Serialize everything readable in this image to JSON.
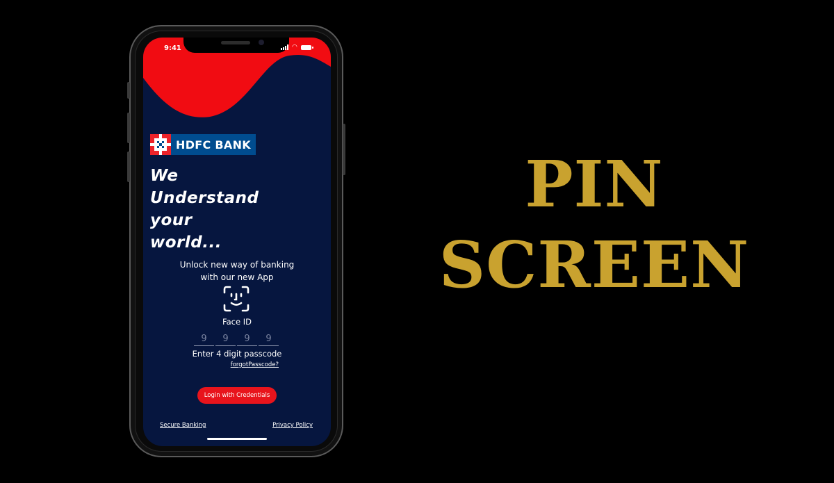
{
  "status_bar": {
    "time": "9:41"
  },
  "brand": {
    "name": "HDFC BANK",
    "red": "#ed232a",
    "blue": "#004c8f",
    "screen_bg": "#06163f",
    "accent_gold": "#c9a22f"
  },
  "hero": {
    "tagline_lines": [
      "We",
      "Understand",
      "your",
      "world..."
    ]
  },
  "intro": {
    "line1": "Unlock new way of banking",
    "line2": "with our new App"
  },
  "face_id": {
    "icon": "face-id-icon",
    "label": "Face ID"
  },
  "passcode": {
    "digits": [
      "9",
      "9",
      "9",
      "9"
    ],
    "label": "Enter 4 digit passcode",
    "forgot_link": "forgotPasscode?"
  },
  "login_button": {
    "label": "Login with Credentials"
  },
  "footer": {
    "left_link": "Secure Banking",
    "right_link": "Privacy Policy"
  },
  "headline": {
    "line1": "PIN",
    "line2": "SCREEN"
  }
}
